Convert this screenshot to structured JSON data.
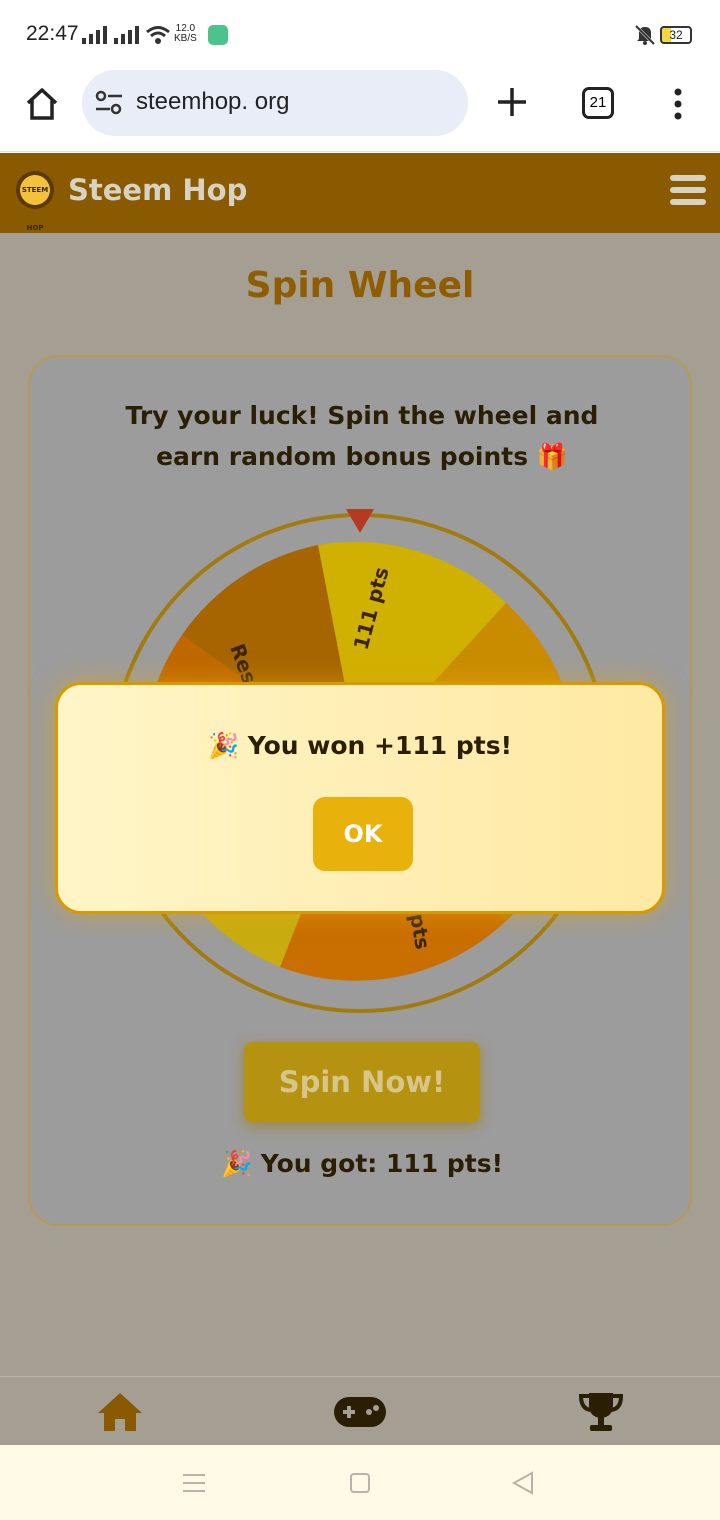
{
  "status_bar": {
    "time": "22:47",
    "net_speed_value": "12.0",
    "net_speed_unit": "KB/S",
    "battery": "32"
  },
  "browser": {
    "url": "steemhop. org",
    "tab_count": "21"
  },
  "app": {
    "brand": "Steem Hop",
    "logo_text": "STEEM HOP"
  },
  "page": {
    "title": "Spin Wheel",
    "description": "Try your luck! Spin the wheel and earn random bonus points 🎁",
    "wheel_labels": {
      "left": "Respin",
      "top": "111 pts",
      "bottom": "pts"
    },
    "spin_button": "Spin Now!",
    "result": "🎉 You got: 111 pts!"
  },
  "modal": {
    "message": "🎉 You won +111 pts!",
    "ok_label": "OK"
  },
  "bottom_nav": {
    "items": [
      "home",
      "games",
      "leaderboard"
    ]
  },
  "colors": {
    "header": "#8a5a00",
    "accent": "#e8b10c",
    "title": "#8f5d00"
  }
}
